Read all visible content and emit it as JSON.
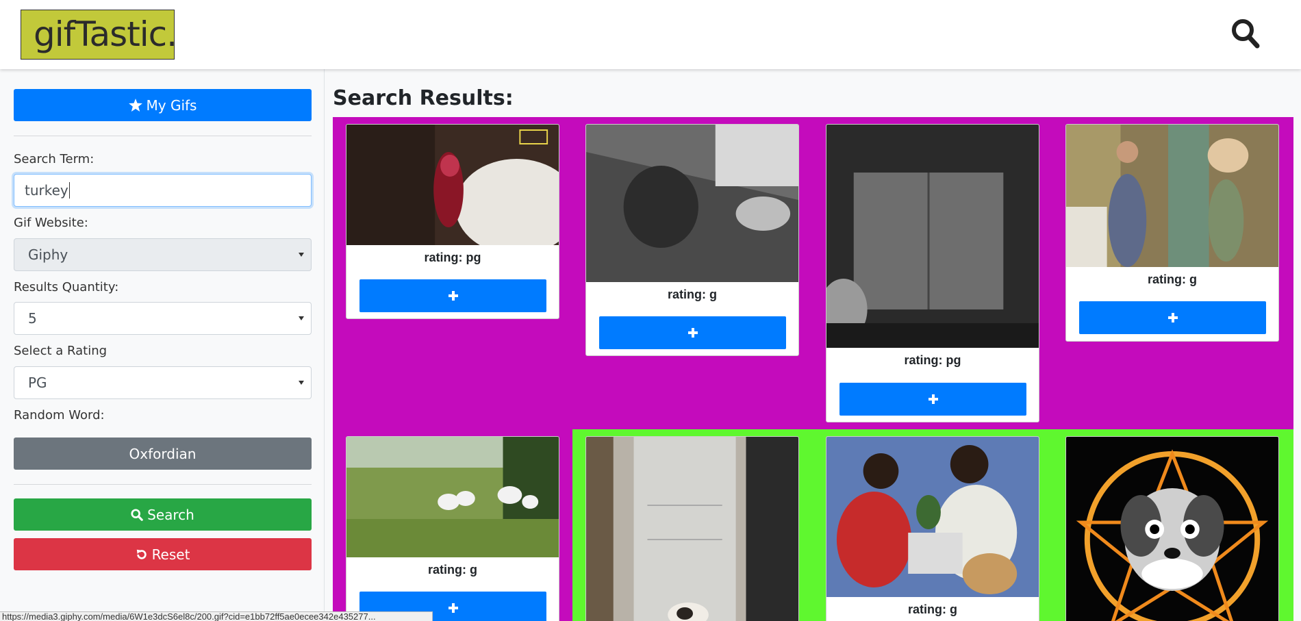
{
  "header": {
    "logo_text": "gifTastic.",
    "search_icon": "search-icon"
  },
  "sidebar": {
    "my_gifs_label": "My Gifs",
    "search_term_label": "Search Term:",
    "search_term_value": "turkey",
    "gif_website_label": "Gif Website:",
    "gif_website_value": "Giphy",
    "results_quantity_label": "Results Quantity:",
    "results_quantity_value": "5",
    "rating_label": "Select a Rating",
    "rating_value": "PG",
    "random_word_label": "Random Word:",
    "random_word_value": "Oxfordian",
    "search_button_label": "Search",
    "reset_button_label": "Reset"
  },
  "main": {
    "title": "Search Results:",
    "row_colors": [
      "#c40bbc",
      "#5ff72f"
    ],
    "cards": [
      {
        "rating": "rating: pg",
        "add_label": "+"
      },
      {
        "rating": "rating: g",
        "add_label": "+"
      },
      {
        "rating": "rating: pg",
        "add_label": "+"
      },
      {
        "rating": "rating: g",
        "add_label": "+"
      },
      {
        "rating": "rating: g",
        "add_label": "+"
      },
      {
        "rating": "",
        "add_label": ""
      },
      {
        "rating": "rating: g",
        "add_label": ""
      },
      {
        "rating": "",
        "add_label": ""
      }
    ]
  },
  "status_bar": {
    "url": "https://media3.giphy.com/media/6W1e3dcS6el8c/200.gif?cid=e1bb72ff5ae0ecee342e435277..."
  },
  "colors": {
    "primary": "#007bff",
    "secondary": "#6c757d",
    "success": "#28a745",
    "danger": "#dc3545",
    "logo_bg": "#c2c93a"
  }
}
